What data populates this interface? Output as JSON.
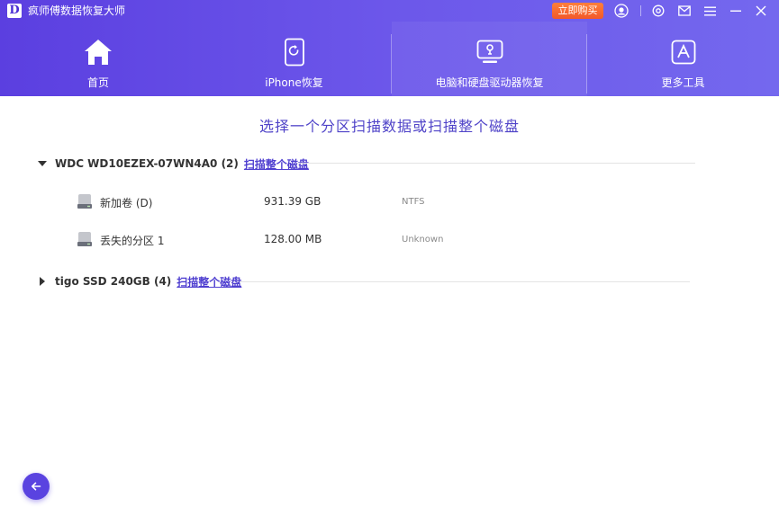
{
  "window": {
    "logo_letter": "D",
    "title": "疯师傅数据恢复大师",
    "buy_button": "立即购买",
    "icons": [
      "user-icon",
      "target-icon",
      "mail-icon",
      "menu-icon",
      "minimize-icon",
      "close-icon"
    ]
  },
  "nav": {
    "tabs": [
      {
        "label": "首页",
        "icon": "home-icon",
        "active": false
      },
      {
        "label": "iPhone恢复",
        "icon": "phone-restore-icon",
        "active": false
      },
      {
        "label": "电脑和硬盘驱动器恢复",
        "icon": "drive-icon",
        "active": true
      },
      {
        "label": "更多工具",
        "icon": "tools-icon",
        "active": false
      }
    ]
  },
  "main": {
    "heading": "选择一个分区扫描数据或扫描整个磁盘",
    "disks": [
      {
        "name": "WDC WD10EZEX-07WN4A0 (2)",
        "scan_link": "扫描整个磁盘",
        "expanded": true,
        "partitions": [
          {
            "name": "新加卷 (D)",
            "size": "931.39 GB",
            "fs": "NTFS"
          },
          {
            "name": "丢失的分区 1",
            "size": "128.00 MB",
            "fs": "Unknown"
          }
        ]
      },
      {
        "name": "tigo SSD 240GB (4)",
        "scan_link": "扫描整个磁盘",
        "expanded": false,
        "partitions": []
      }
    ]
  },
  "colors": {
    "header_start": "#5b3fe0",
    "header_end": "#7468ee",
    "accent": "#4f43c8",
    "buy_button": "#f2592a"
  },
  "back_button_icon": "arrow-left-icon"
}
